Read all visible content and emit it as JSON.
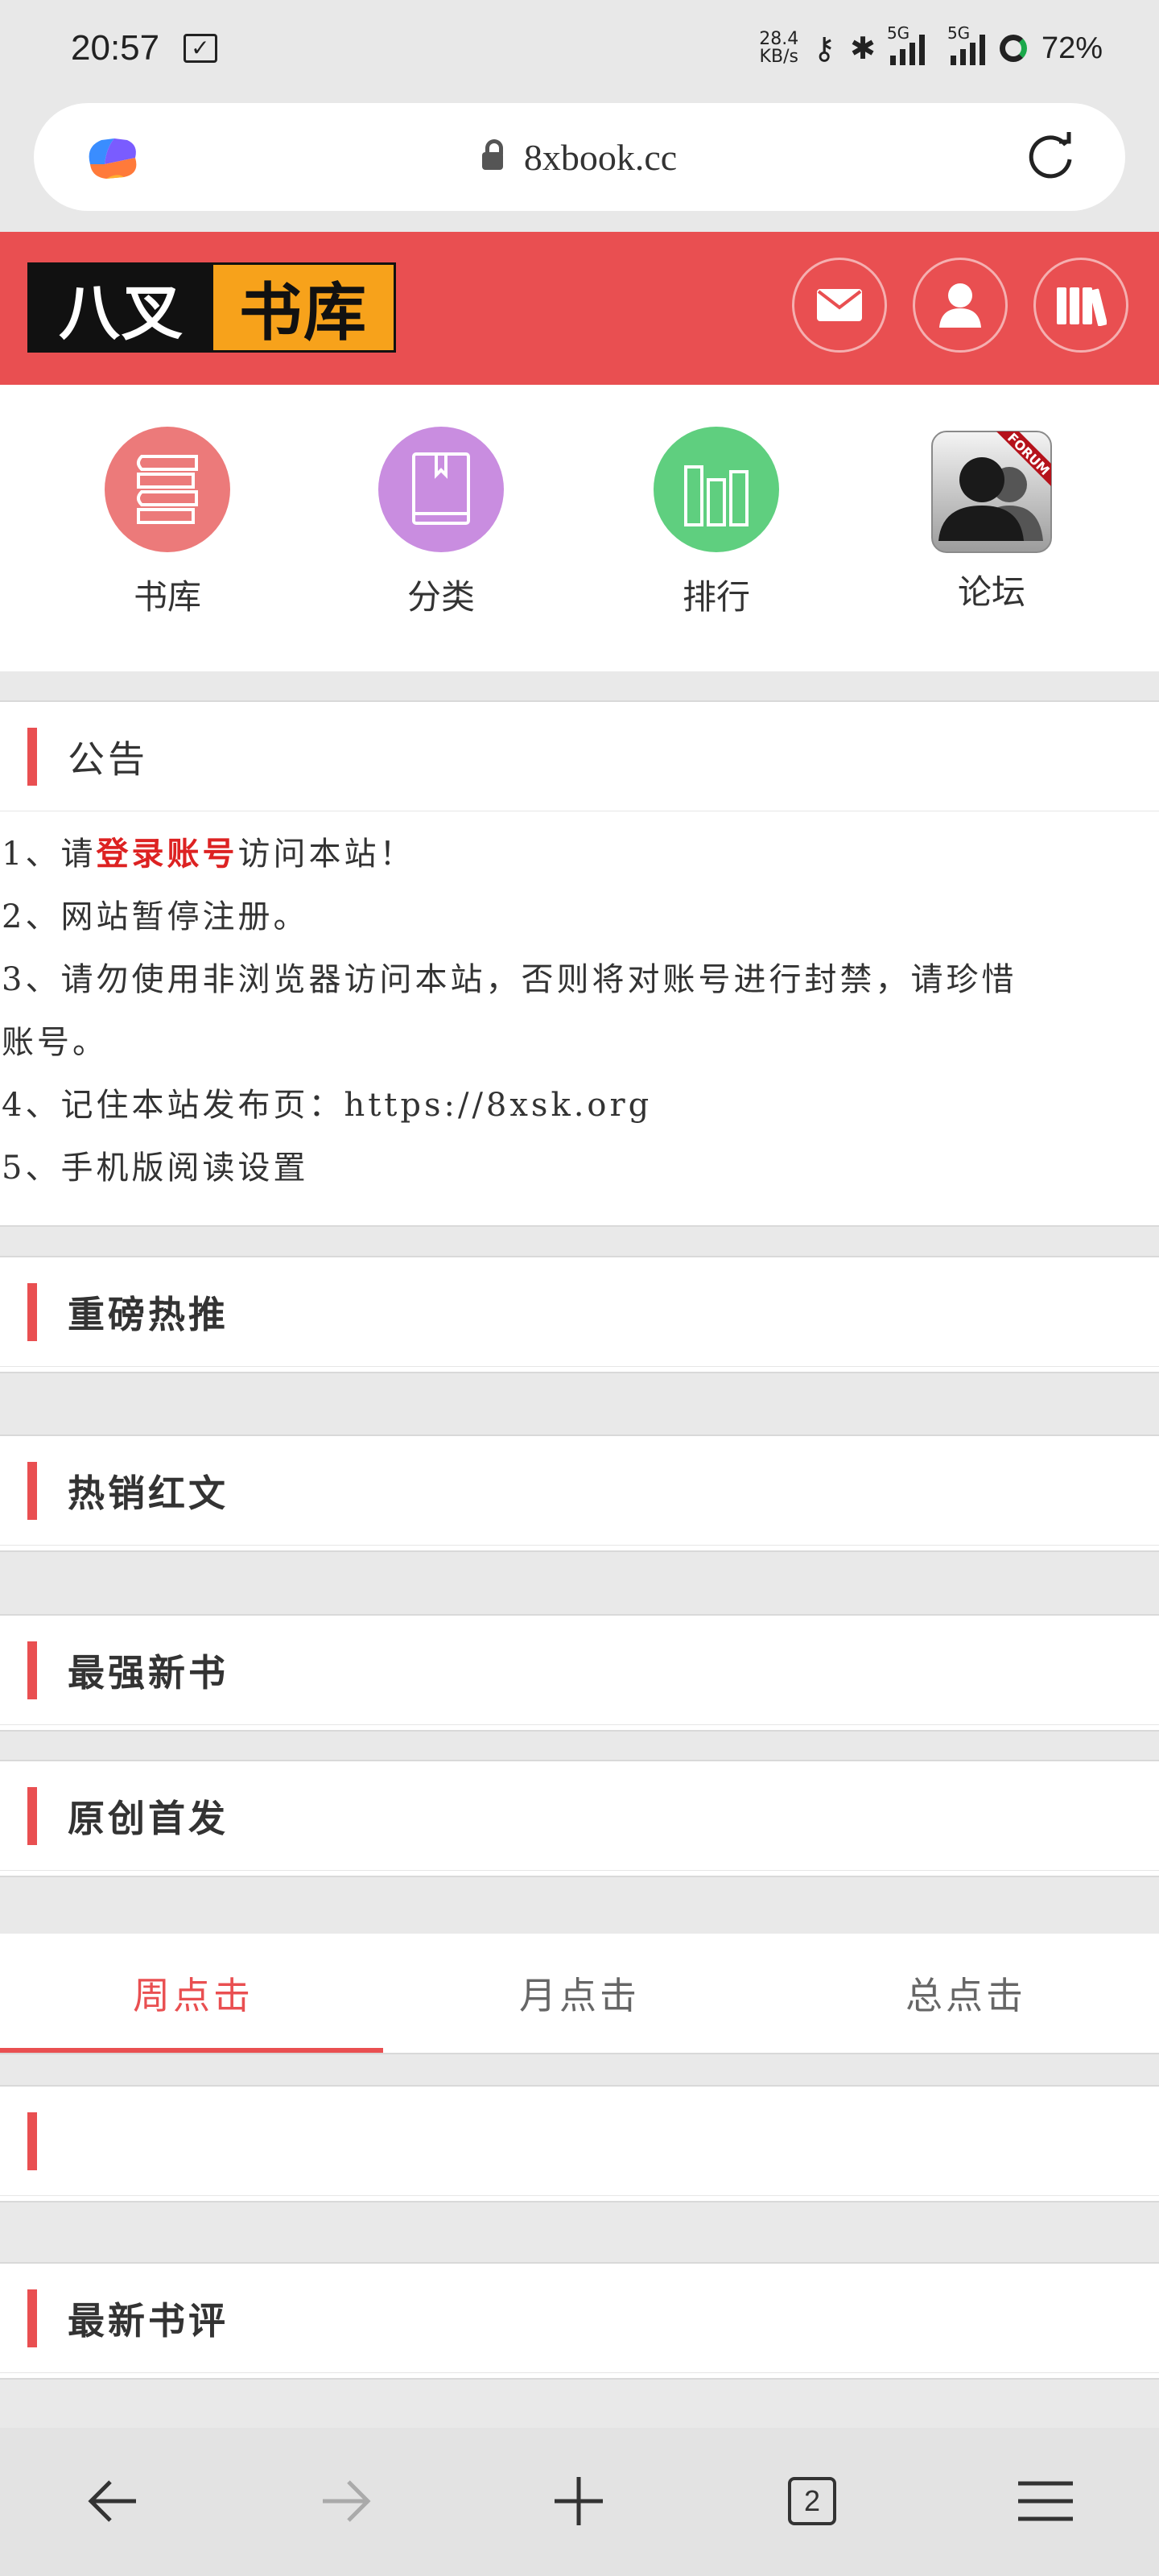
{
  "status": {
    "time": "20:57",
    "net_speed_top": "28.4",
    "net_speed_bottom": "KB/s",
    "sig1": "5G",
    "sig2": "5G",
    "battery": "72%"
  },
  "browser": {
    "url": "8xbook.cc",
    "tab_count": "2"
  },
  "header": {
    "logo_left": "八叉",
    "logo_right": "书库"
  },
  "nav": [
    {
      "label": "书库",
      "color": "#ec7a7a"
    },
    {
      "label": "分类",
      "color": "#c98de0"
    },
    {
      "label": "排行",
      "color": "#5fcf7f"
    },
    {
      "label": "论坛",
      "badge": "FORUM"
    }
  ],
  "notice": {
    "title": "公告",
    "lines": [
      {
        "pre": "1、请",
        "link": "登录账号",
        "post": "访问本站！"
      },
      {
        "text": "2、网站暂停注册。"
      },
      {
        "text": "3、请勿使用非浏览器访问本站，否则将对账号进行封禁，请珍惜"
      },
      {
        "text": "账号。"
      },
      {
        "text": "4、记住本站发布页：https://8xsk.org"
      },
      {
        "text": "5、手机版阅读设置"
      }
    ]
  },
  "sections": [
    {
      "title": "重磅热推"
    },
    {
      "title": "热销红文"
    },
    {
      "title": "最强新书"
    },
    {
      "title": "原创首发"
    },
    {
      "title": ""
    },
    {
      "title": "最新书评"
    }
  ],
  "tabs": [
    "周点击",
    "月点击",
    "总点击"
  ],
  "colors": {
    "accent": "#e94f51",
    "logo_orange": "#f7a21b"
  }
}
